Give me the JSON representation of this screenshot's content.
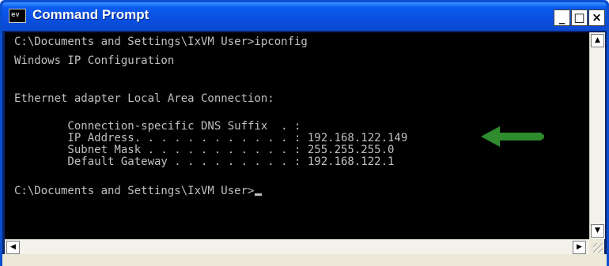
{
  "window": {
    "title": "Command Prompt",
    "icon_label": "ev",
    "buttons": {
      "minimize": "_",
      "maximize": "□",
      "close": "×"
    }
  },
  "console": {
    "lines": [
      "C:\\Documents and Settings\\IxVM User>ipconfig",
      "Windows IP Configuration",
      "Ethernet adapter Local Area Connection:",
      "        Connection-specific DNS Suffix  . :",
      "        IP Address. . . . . . . . . . . . : 192.168.122.149",
      "        Subnet Mask . . . . . . . . . . . : 255.255.255.0",
      "        Default Gateway . . . . . . . . . : 192.168.122.1",
      "C:\\Documents and Settings\\IxVM User>"
    ]
  },
  "scrollbars": {
    "up": "▲",
    "down": "▼",
    "left": "◀",
    "right": "▶"
  },
  "colors": {
    "console_bg": "#000000",
    "console_text": "#c0c0c0",
    "titlebar": "#0a4fe0",
    "annotation_arrow": "#2e8b2e"
  },
  "icons": {
    "window": "console-app-icon",
    "annotation": "green-arrow-icon"
  }
}
